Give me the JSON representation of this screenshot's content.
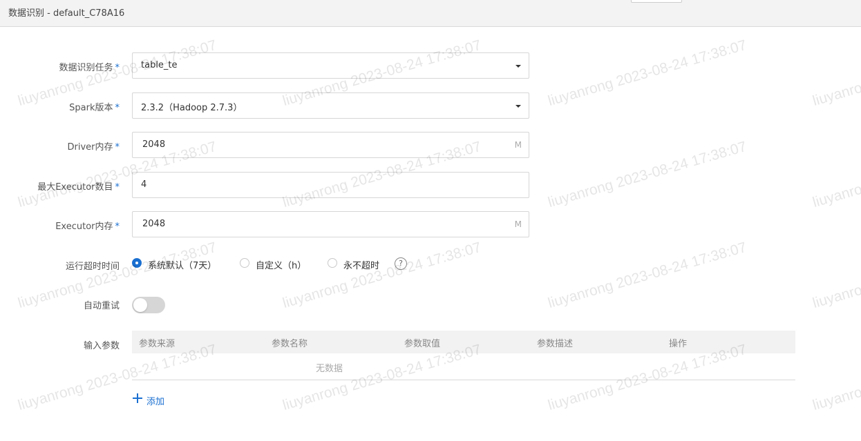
{
  "window": {
    "title": "数据识别 - default_C78A16"
  },
  "form": {
    "task": {
      "label": "数据识别任务",
      "required": "*",
      "value": "table_te"
    },
    "spark": {
      "label": "Spark版本",
      "required": "*",
      "value": "2.3.2（Hadoop 2.7.3）"
    },
    "driver_mem": {
      "label": "Driver内存",
      "required": "*",
      "value": "2048",
      "unit": "M"
    },
    "max_executors": {
      "label": "最大Executor数目",
      "required": "*",
      "value": "4"
    },
    "executor_mem": {
      "label": "Executor内存",
      "required": "*",
      "value": "2048",
      "unit": "M"
    },
    "timeout": {
      "label": "运行超时时间",
      "options": [
        "系统默认（7天）",
        "自定义（h）",
        "永不超时"
      ],
      "selected": "系统默认（7天）",
      "help": "?"
    },
    "auto_retry": {
      "label": "自动重试",
      "enabled": false
    },
    "params": {
      "label": "输入参数",
      "columns": [
        "参数来源",
        "参数名称",
        "参数取值",
        "参数描述",
        "操作"
      ],
      "empty_text": "无数据",
      "add_label": "添加"
    }
  },
  "watermark": "liuyanrong 2023-08-24 17:38:07",
  "colors": {
    "accent": "#1a6fd0",
    "header_bg": "#f3f3f3",
    "table_head_bg": "#f2f2f2"
  }
}
